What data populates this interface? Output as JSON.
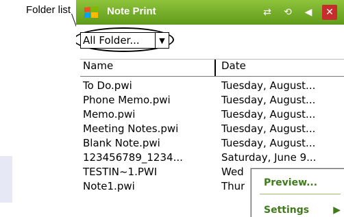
{
  "annotation": {
    "label": "Folder list"
  },
  "window": {
    "title": "Note Print"
  },
  "status_icons": [
    "network-icon",
    "sync-icon",
    "speaker-icon",
    "close-icon"
  ],
  "folder": {
    "value": "All Folder..."
  },
  "table": {
    "headers": {
      "name": "Name",
      "date": "Date"
    },
    "rows": [
      {
        "name": "To Do.pwi",
        "date": "Tuesday, August..."
      },
      {
        "name": "Phone Memo.pwi",
        "date": "Tuesday, August..."
      },
      {
        "name": "Memo.pwi",
        "date": "Tuesday, August..."
      },
      {
        "name": "Meeting Notes.pwi",
        "date": "Tuesday, August..."
      },
      {
        "name": "Blank Note.pwi",
        "date": "Tuesday, August..."
      },
      {
        "name": "123456789_1234...",
        "date": "Saturday, June 9..."
      },
      {
        "name": "TESTIN~1.PWI",
        "date": "Wed"
      },
      {
        "name": "Note1.pwi",
        "date": "Thur"
      }
    ]
  },
  "popup": {
    "preview": "Preview...",
    "settings": "Settings",
    "settings_arrow": "▶"
  },
  "colors": {
    "titlebar": "#6aa622",
    "close": "#c62d2d",
    "popup_text": "#3f7a1c"
  }
}
